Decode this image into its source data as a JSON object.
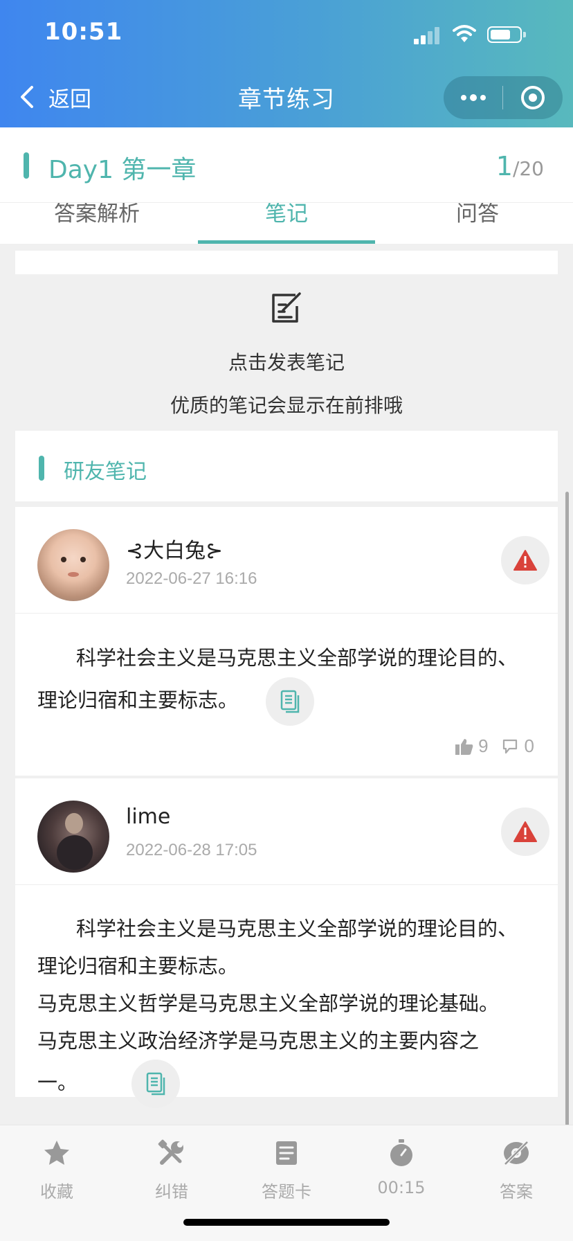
{
  "status_bar": {
    "time": "10:51"
  },
  "nav": {
    "back_label": "返回",
    "title": "章节练习"
  },
  "chapter": {
    "title": "Day1 第一章",
    "progress_current": "1",
    "progress_total": "/20"
  },
  "tabs": [
    {
      "label": "答案解析",
      "active": false
    },
    {
      "label": "笔记",
      "active": true
    },
    {
      "label": "问答",
      "active": false
    }
  ],
  "post_note": {
    "line1": "点击发表笔记",
    "line2": "优质的笔记会显示在前排哦"
  },
  "section": {
    "title": "研友笔记"
  },
  "notes": [
    {
      "name": "大白兔",
      "time": "2022-06-27 16:16",
      "lines": [
        "科学社会主义是马克思主义全部学说的理论目的、",
        "理论归宿和主要标志。"
      ],
      "likes": "9",
      "comments": "0"
    },
    {
      "name": "lime",
      "time": "2022-06-28 17:05",
      "lines": [
        "科学社会主义是马克思主义全部学说的理论目的、",
        "理论归宿和主要标志。",
        "马克思主义哲学是马克思主义全部学说的理论基础。",
        "马克思主义政治经济学是马克思主义的主要内容之",
        "一。"
      ]
    }
  ],
  "bottom_bar": [
    {
      "label": "收藏",
      "icon": "star-icon"
    },
    {
      "label": "纠错",
      "icon": "tools-icon"
    },
    {
      "label": "答题卡",
      "icon": "answer-card-icon"
    },
    {
      "label": "00:15",
      "icon": "stopwatch-icon"
    },
    {
      "label": "答案",
      "icon": "eye-slash-icon"
    }
  ],
  "colors": {
    "accent": "#4fb5ad",
    "warning": "#d9423a",
    "header_gradient_start": "#3f86ef",
    "header_gradient_end": "#58b9bd"
  }
}
